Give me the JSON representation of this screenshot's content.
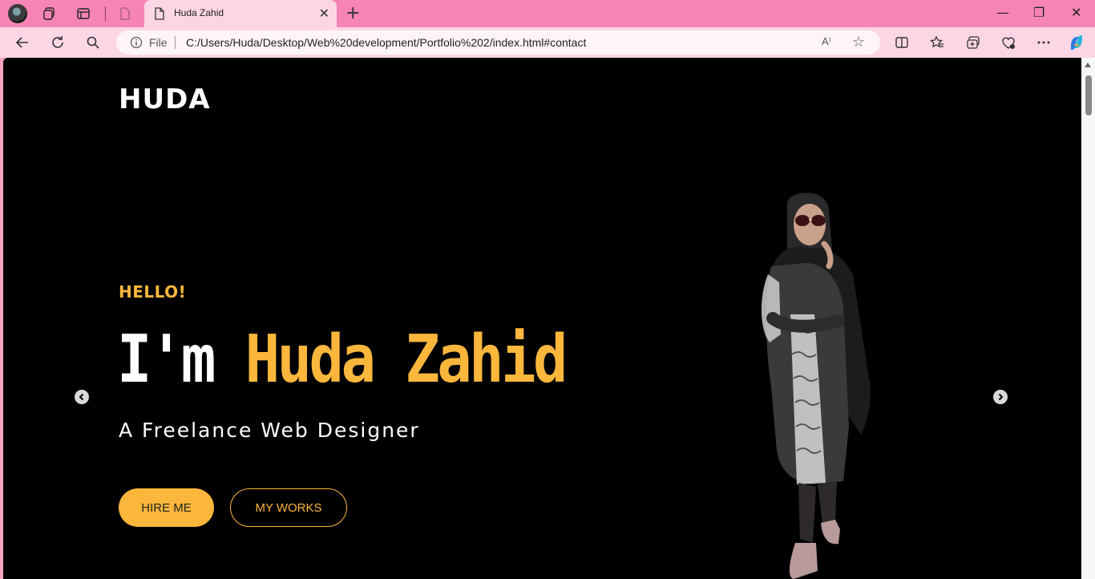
{
  "browser": {
    "tab": {
      "title": "Huda Zahid"
    },
    "address": {
      "scheme_label": "File",
      "url": "C:/Users/Huda/Desktop/Web%20development/Portfolio%202/index.html#contact"
    }
  },
  "page": {
    "logo": "HUDA",
    "greeting": "HELLO!",
    "headline_prefix": "I'm ",
    "headline_name": "Huda Zahid",
    "subtitle": "A Freelance Web Designer",
    "buttons": {
      "hire": "HIRE ME",
      "works": "MY WORKS"
    }
  },
  "colors": {
    "accent": "#fbb73c",
    "background": "#000000",
    "browser_frame": "#f684b5",
    "toolbar": "#fdd6e5"
  }
}
